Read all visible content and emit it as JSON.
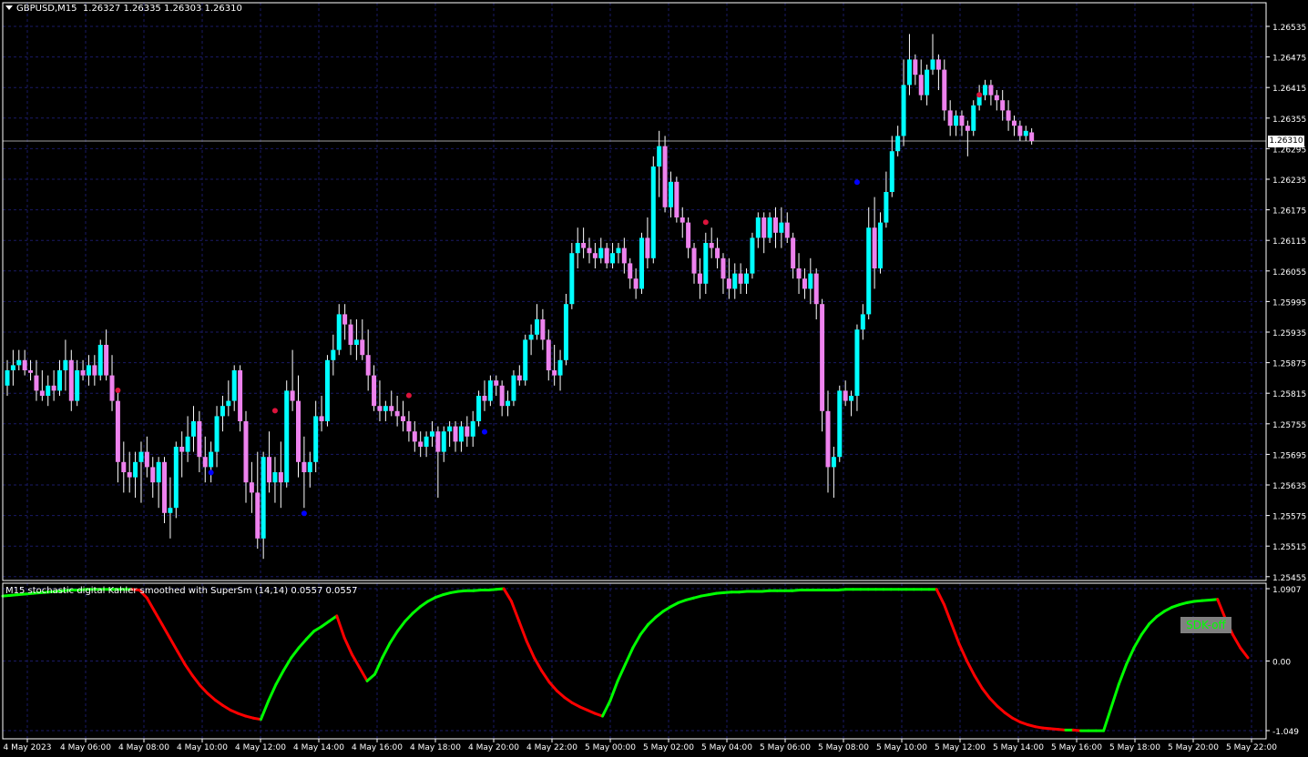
{
  "header": {
    "symbol": "GBPUSD,M15",
    "ohlc": "1.26327 1.26335 1.26303 1.26310"
  },
  "price_axis": {
    "labels": [
      "1.26535",
      "1.26475",
      "1.26415",
      "1.26355",
      "1.26295",
      "1.26235",
      "1.26175",
      "1.26115",
      "1.26055",
      "1.25995",
      "1.25935",
      "1.25875",
      "1.25815",
      "1.25755",
      "1.25695",
      "1.25635",
      "1.25575",
      "1.25515",
      "1.25455"
    ],
    "current_price": "1.26310"
  },
  "indicator": {
    "title": "M15 stochastic digital Kahler smoothed with SuperSm (14,14) 0.0557 0.0557",
    "axis_labels": [
      "1.0907",
      "0.00",
      "-1.049"
    ],
    "badge": "SDK-off"
  },
  "time_axis": {
    "labels": [
      "4 May 2023",
      "4 May 06:00",
      "4 May 08:00",
      "4 May 10:00",
      "4 May 12:00",
      "4 May 14:00",
      "4 May 16:00",
      "4 May 18:00",
      "4 May 20:00",
      "4 May 22:00",
      "5 May 00:00",
      "5 May 02:00",
      "5 May 04:00",
      "5 May 06:00",
      "5 May 08:00",
      "5 May 10:00",
      "5 May 12:00",
      "5 May 14:00",
      "5 May 16:00",
      "5 May 18:00",
      "5 May 20:00",
      "5 May 22:00"
    ]
  },
  "colors": {
    "background": "#000000",
    "grid": "#1a1a66",
    "bull_candle": "#00ffff",
    "bear_candle": "#ee82ee",
    "wick": "#ffffff",
    "up_dot": "#0000ff",
    "down_dot": "#dc143c",
    "indicator_up": "#00ff00",
    "indicator_down": "#ff0000"
  },
  "chart_data": {
    "type": "candlestick",
    "symbol": "GBPUSD",
    "timeframe": "M15",
    "y_range": [
      1.25455,
      1.26535
    ],
    "candles": [
      [
        1.2583,
        1.2588,
        1.2581,
        1.2586
      ],
      [
        1.2586,
        1.259,
        1.2583,
        1.2587
      ],
      [
        1.2587,
        1.259,
        1.2586,
        1.2588
      ],
      [
        1.2588,
        1.259,
        1.2585,
        1.2586
      ],
      [
        1.2586,
        1.2588,
        1.2584,
        1.25855
      ],
      [
        1.2585,
        1.2588,
        1.258,
        1.2582
      ],
      [
        1.2582,
        1.2586,
        1.258,
        1.2581
      ],
      [
        1.2581,
        1.2585,
        1.2579,
        1.2583
      ],
      [
        1.2583,
        1.2586,
        1.258,
        1.2582
      ],
      [
        1.2582,
        1.2588,
        1.2581,
        1.2586
      ],
      [
        1.2586,
        1.2592,
        1.2582,
        1.2588
      ],
      [
        1.2588,
        1.259,
        1.2578,
        1.258
      ],
      [
        1.258,
        1.2588,
        1.2579,
        1.2586
      ],
      [
        1.2586,
        1.2588,
        1.2584,
        1.2585
      ],
      [
        1.2585,
        1.2589,
        1.2583,
        1.2587
      ],
      [
        1.2587,
        1.2589,
        1.2583,
        1.2585
      ],
      [
        1.2585,
        1.2592,
        1.2584,
        1.2591
      ],
      [
        1.2591,
        1.2594,
        1.2584,
        1.2585
      ],
      [
        1.2585,
        1.2589,
        1.2578,
        1.258
      ],
      [
        1.258,
        1.2582,
        1.2564,
        1.2568
      ],
      [
        1.2568,
        1.2572,
        1.2562,
        1.2566
      ],
      [
        1.2566,
        1.257,
        1.2562,
        1.2565
      ],
      [
        1.2565,
        1.257,
        1.2561,
        1.2568
      ],
      [
        1.2568,
        1.2572,
        1.256,
        1.257
      ],
      [
        1.257,
        1.2573,
        1.2565,
        1.2567
      ],
      [
        1.2567,
        1.2569,
        1.2561,
        1.2564
      ],
      [
        1.2564,
        1.2569,
        1.2559,
        1.2568
      ],
      [
        1.2568,
        1.2569,
        1.2556,
        1.2558
      ],
      [
        1.2558,
        1.2565,
        1.2553,
        1.2559
      ],
      [
        1.2559,
        1.2572,
        1.2557,
        1.2571
      ],
      [
        1.2571,
        1.2574,
        1.2565,
        1.257
      ],
      [
        1.257,
        1.2577,
        1.2568,
        1.2573
      ],
      [
        1.2573,
        1.2579,
        1.257,
        1.2576
      ],
      [
        1.2576,
        1.2578,
        1.2566,
        1.2569
      ],
      [
        1.2569,
        1.2573,
        1.2564,
        1.2567
      ],
      [
        1.2567,
        1.2572,
        1.2564,
        1.257
      ],
      [
        1.257,
        1.2579,
        1.2567,
        1.2577
      ],
      [
        1.2577,
        1.2581,
        1.2574,
        1.2579
      ],
      [
        1.2579,
        1.2584,
        1.2577,
        1.258
      ],
      [
        1.258,
        1.2587,
        1.2578,
        1.2586
      ],
      [
        1.2586,
        1.2587,
        1.2574,
        1.2576
      ],
      [
        1.2576,
        1.2578,
        1.256,
        1.2564
      ],
      [
        1.2564,
        1.2568,
        1.2558,
        1.2562
      ],
      [
        1.2562,
        1.257,
        1.2551,
        1.2553
      ],
      [
        1.2553,
        1.257,
        1.2549,
        1.2569
      ],
      [
        1.2569,
        1.2574,
        1.2562,
        1.2564
      ],
      [
        1.2564,
        1.2569,
        1.256,
        1.2566
      ],
      [
        1.2566,
        1.2572,
        1.2559,
        1.2564
      ],
      [
        1.2564,
        1.2584,
        1.2563,
        1.2582
      ],
      [
        1.2582,
        1.259,
        1.2578,
        1.258
      ],
      [
        1.258,
        1.2585,
        1.2565,
        1.2568
      ],
      [
        1.2568,
        1.2573,
        1.2559,
        1.2566
      ],
      [
        1.2566,
        1.257,
        1.2563,
        1.2568
      ],
      [
        1.2568,
        1.258,
        1.2566,
        1.2577
      ],
      [
        1.2577,
        1.2581,
        1.2574,
        1.2576
      ],
      [
        1.2576,
        1.2589,
        1.2575,
        1.2588
      ],
      [
        1.2588,
        1.2593,
        1.2585,
        1.259
      ],
      [
        1.259,
        1.2599,
        1.2589,
        1.2597
      ],
      [
        1.2597,
        1.2599,
        1.2592,
        1.2595
      ],
      [
        1.2595,
        1.2596,
        1.2589,
        1.2591
      ],
      [
        1.2591,
        1.2596,
        1.2588,
        1.2592
      ],
      [
        1.2592,
        1.2596,
        1.2588,
        1.2589
      ],
      [
        1.2589,
        1.2594,
        1.2582,
        1.2585
      ],
      [
        1.2585,
        1.2587,
        1.2578,
        1.2579
      ],
      [
        1.2579,
        1.2584,
        1.2576,
        1.2578
      ],
      [
        1.2578,
        1.258,
        1.2576,
        1.2579
      ],
      [
        1.2579,
        1.2582,
        1.2577,
        1.2578
      ],
      [
        1.2578,
        1.2581,
        1.2575,
        1.2577
      ],
      [
        1.2577,
        1.258,
        1.2574,
        1.2576
      ],
      [
        1.2576,
        1.2578,
        1.2572,
        1.2574
      ],
      [
        1.2574,
        1.2576,
        1.257,
        1.2572
      ],
      [
        1.2572,
        1.2574,
        1.2569,
        1.2571
      ],
      [
        1.2571,
        1.2574,
        1.2569,
        1.2573
      ],
      [
        1.2573,
        1.2576,
        1.2571,
        1.2574
      ],
      [
        1.2574,
        1.2575,
        1.2561,
        1.257
      ],
      [
        1.257,
        1.2575,
        1.2568,
        1.2574
      ],
      [
        1.2574,
        1.2576,
        1.2571,
        1.2575
      ],
      [
        1.2575,
        1.2576,
        1.257,
        1.2572
      ],
      [
        1.2572,
        1.2576,
        1.257,
        1.2575
      ],
      [
        1.2575,
        1.2577,
        1.2571,
        1.2573
      ],
      [
        1.2573,
        1.2578,
        1.2571,
        1.2576
      ],
      [
        1.2576,
        1.2582,
        1.2575,
        1.2581
      ],
      [
        1.2581,
        1.2584,
        1.2578,
        1.258
      ],
      [
        1.258,
        1.2585,
        1.2579,
        1.2584
      ],
      [
        1.2584,
        1.2585,
        1.2581,
        1.2583
      ],
      [
        1.2583,
        1.2584,
        1.2577,
        1.2579
      ],
      [
        1.2579,
        1.2582,
        1.2577,
        1.258
      ],
      [
        1.258,
        1.2586,
        1.2579,
        1.2585
      ],
      [
        1.2585,
        1.2587,
        1.2583,
        1.2584
      ],
      [
        1.2584,
        1.2593,
        1.2583,
        1.2592
      ],
      [
        1.2592,
        1.2595,
        1.2589,
        1.2593
      ],
      [
        1.2593,
        1.2599,
        1.2592,
        1.2596
      ],
      [
        1.2596,
        1.2598,
        1.259,
        1.2592
      ],
      [
        1.2592,
        1.2594,
        1.2584,
        1.2586
      ],
      [
        1.2586,
        1.2591,
        1.2583,
        1.2585
      ],
      [
        1.2585,
        1.259,
        1.2582,
        1.2588
      ],
      [
        1.2588,
        1.2601,
        1.2587,
        1.2599
      ],
      [
        1.2599,
        1.2611,
        1.2598,
        1.2609
      ],
      [
        1.2609,
        1.2614,
        1.2606,
        1.2611
      ],
      [
        1.2611,
        1.2614,
        1.2608,
        1.261
      ],
      [
        1.261,
        1.2612,
        1.2607,
        1.2609
      ],
      [
        1.2609,
        1.2611,
        1.2606,
        1.2608
      ],
      [
        1.2608,
        1.2612,
        1.2607,
        1.261
      ],
      [
        1.261,
        1.2611,
        1.2606,
        1.2607
      ],
      [
        1.2607,
        1.2611,
        1.2606,
        1.2609
      ],
      [
        1.2609,
        1.2611,
        1.2607,
        1.261
      ],
      [
        1.261,
        1.2612,
        1.2605,
        1.2607
      ],
      [
        1.2607,
        1.2608,
        1.2602,
        1.2604
      ],
      [
        1.2604,
        1.2606,
        1.26,
        1.2602
      ],
      [
        1.2602,
        1.2613,
        1.2601,
        1.2612
      ],
      [
        1.2612,
        1.2616,
        1.2606,
        1.2608
      ],
      [
        1.2608,
        1.2628,
        1.2607,
        1.2626
      ],
      [
        1.2626,
        1.2633,
        1.262,
        1.263
      ],
      [
        1.263,
        1.2632,
        1.2617,
        1.2618
      ],
      [
        1.2618,
        1.2625,
        1.2616,
        1.2623
      ],
      [
        1.2623,
        1.2624,
        1.2615,
        1.2616
      ],
      [
        1.2616,
        1.2618,
        1.2612,
        1.2615
      ],
      [
        1.2615,
        1.2616,
        1.2608,
        1.261
      ],
      [
        1.261,
        1.2611,
        1.2603,
        1.2605
      ],
      [
        1.2605,
        1.2608,
        1.26,
        1.2603
      ],
      [
        1.2603,
        1.2613,
        1.2601,
        1.2611
      ],
      [
        1.2611,
        1.2614,
        1.2608,
        1.261
      ],
      [
        1.261,
        1.2612,
        1.2606,
        1.2608
      ],
      [
        1.2608,
        1.2609,
        1.2601,
        1.2604
      ],
      [
        1.2604,
        1.2608,
        1.26,
        1.2602
      ],
      [
        1.2602,
        1.2607,
        1.26,
        1.2605
      ],
      [
        1.2605,
        1.2607,
        1.2601,
        1.2603
      ],
      [
        1.2603,
        1.2606,
        1.2601,
        1.2605
      ],
      [
        1.2605,
        1.2613,
        1.2604,
        1.2612
      ],
      [
        1.2612,
        1.2617,
        1.261,
        1.2616
      ],
      [
        1.2616,
        1.2617,
        1.2609,
        1.2612
      ],
      [
        1.2612,
        1.2617,
        1.2611,
        1.2616
      ],
      [
        1.2616,
        1.2618,
        1.261,
        1.2613
      ],
      [
        1.2613,
        1.2618,
        1.261,
        1.2615
      ],
      [
        1.2615,
        1.2617,
        1.2611,
        1.2612
      ],
      [
        1.2612,
        1.2613,
        1.2604,
        1.2606
      ],
      [
        1.2606,
        1.2609,
        1.2601,
        1.2604
      ],
      [
        1.2604,
        1.2606,
        1.26,
        1.2602
      ],
      [
        1.2602,
        1.2608,
        1.2599,
        1.2605
      ],
      [
        1.2605,
        1.2606,
        1.2596,
        1.2599
      ],
      [
        1.2599,
        1.26,
        1.2574,
        1.2578
      ],
      [
        1.2578,
        1.2582,
        1.2562,
        1.2567
      ],
      [
        1.2567,
        1.2571,
        1.2561,
        1.2569
      ],
      [
        1.2569,
        1.2583,
        1.2568,
        1.2582
      ],
      [
        1.2582,
        1.2584,
        1.2579,
        1.258
      ],
      [
        1.258,
        1.2582,
        1.2577,
        1.2581
      ],
      [
        1.2581,
        1.2595,
        1.2578,
        1.2594
      ],
      [
        1.2594,
        1.2599,
        1.2592,
        1.2597
      ],
      [
        1.2597,
        1.2618,
        1.2596,
        1.2614
      ],
      [
        1.2614,
        1.262,
        1.2602,
        1.2606
      ],
      [
        1.2606,
        1.2617,
        1.2605,
        1.2615
      ],
      [
        1.2615,
        1.2625,
        1.2614,
        1.2621
      ],
      [
        1.2621,
        1.2632,
        1.262,
        1.2629
      ],
      [
        1.2629,
        1.2634,
        1.2628,
        1.2632
      ],
      [
        1.2632,
        1.2647,
        1.263,
        1.2642
      ],
      [
        1.2642,
        1.2652,
        1.264,
        1.2647
      ],
      [
        1.2647,
        1.2648,
        1.2642,
        1.2644
      ],
      [
        1.2644,
        1.2647,
        1.2639,
        1.264
      ],
      [
        1.264,
        1.2646,
        1.2638,
        1.2645
      ],
      [
        1.2645,
        1.2652,
        1.2644,
        1.2647
      ],
      [
        1.2647,
        1.2648,
        1.2641,
        1.2645
      ],
      [
        1.2645,
        1.2647,
        1.2635,
        1.2637
      ],
      [
        1.2637,
        1.2639,
        1.2632,
        1.2634
      ],
      [
        1.2634,
        1.2637,
        1.2632,
        1.2636
      ],
      [
        1.2636,
        1.2637,
        1.2632,
        1.2634
      ],
      [
        1.2634,
        1.2635,
        1.2628,
        1.2633
      ],
      [
        1.2633,
        1.2639,
        1.2632,
        1.2638
      ],
      [
        1.2638,
        1.2642,
        1.2637,
        1.264
      ],
      [
        1.264,
        1.2643,
        1.2639,
        1.2642
      ],
      [
        1.2642,
        1.2643,
        1.2638,
        1.264
      ],
      [
        1.264,
        1.2641,
        1.2637,
        1.2639
      ],
      [
        1.2639,
        1.2641,
        1.2635,
        1.2637
      ],
      [
        1.2637,
        1.2639,
        1.2633,
        1.2635
      ],
      [
        1.2635,
        1.2636,
        1.2632,
        1.2634
      ],
      [
        1.2634,
        1.2635,
        1.2631,
        1.2632
      ],
      [
        1.2632,
        1.2634,
        1.2631,
        1.2633
      ],
      [
        1.26327,
        1.26335,
        1.26303,
        1.2631
      ]
    ],
    "up_arrow_dots": [
      [
        35,
        1.2567
      ],
      [
        51,
        1.2559
      ],
      [
        82,
        1.2575
      ],
      [
        146,
        1.2624
      ]
    ],
    "down_arrow_dots": [
      [
        19,
        1.2581
      ],
      [
        46,
        1.2577
      ],
      [
        69,
        1.258
      ],
      [
        120,
        1.2614
      ],
      [
        167,
        1.2639
      ]
    ],
    "indicator": {
      "name": "stochastic digital Kahler smoothed with SuperSm",
      "params": "(14,14)",
      "y_range": [
        -1.049,
        1.0907
      ],
      "values": [
        0.98,
        0.99,
        1.0,
        1.01,
        1.02,
        1.03,
        1.04,
        1.05,
        1.06,
        1.07,
        1.07,
        1.08,
        1.08,
        1.08,
        1.08,
        1.08,
        1.08,
        1.08,
        1.07,
        0.95,
        0.75,
        0.55,
        0.35,
        0.15,
        -0.05,
        -0.22,
        -0.37,
        -0.49,
        -0.59,
        -0.67,
        -0.74,
        -0.79,
        -0.83,
        -0.86,
        -0.88,
        -0.6,
        -0.35,
        -0.14,
        0.05,
        0.2,
        0.33,
        0.45,
        0.52,
        0.6,
        0.68,
        0.35,
        0.1,
        -0.1,
        -0.3,
        -0.2,
        0.05,
        0.27,
        0.45,
        0.6,
        0.72,
        0.82,
        0.9,
        0.96,
        1.0,
        1.03,
        1.05,
        1.06,
        1.06,
        1.07,
        1.07,
        1.08,
        1.09,
        0.9,
        0.6,
        0.3,
        0.05,
        -0.15,
        -0.32,
        -0.45,
        -0.55,
        -0.63,
        -0.69,
        -0.74,
        -0.79,
        -0.83,
        -0.6,
        -0.3,
        -0.05,
        0.2,
        0.4,
        0.55,
        0.66,
        0.75,
        0.82,
        0.88,
        0.92,
        0.95,
        0.98,
        1.0,
        1.02,
        1.03,
        1.04,
        1.04,
        1.05,
        1.05,
        1.05,
        1.06,
        1.06,
        1.06,
        1.06,
        1.07,
        1.07,
        1.07,
        1.07,
        1.07,
        1.07,
        1.08,
        1.08,
        1.08,
        1.08,
        1.08,
        1.08,
        1.08,
        1.08,
        1.08,
        1.08,
        1.08,
        1.08,
        1.08,
        0.85,
        0.55,
        0.25,
        0.0,
        -0.22,
        -0.41,
        -0.56,
        -0.68,
        -0.78,
        -0.86,
        -0.92,
        -0.96,
        -0.99,
        -1.01,
        -1.02,
        -1.03,
        -1.04,
        -1.04,
        -1.05,
        -1.05,
        -1.05,
        -1.05,
        -0.7,
        -0.35,
        -0.05,
        0.2,
        0.4,
        0.56,
        0.67,
        0.75,
        0.81,
        0.85,
        0.88,
        0.9,
        0.91,
        0.92,
        0.93,
        0.65,
        0.4,
        0.2,
        0.05
      ]
    }
  }
}
